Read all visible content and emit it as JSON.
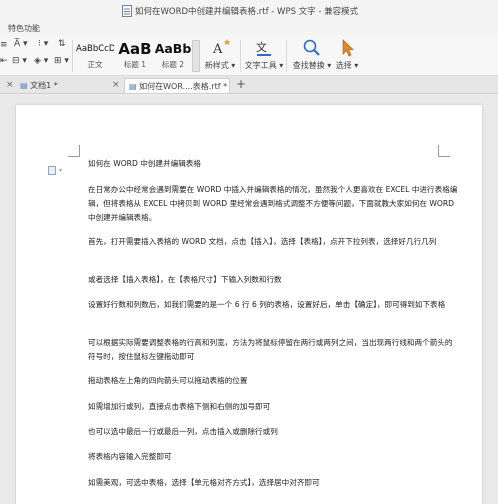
{
  "window": {
    "title": "如何在WORD中创建并编辑表格.rtf - WPS 文字 - 兼容模式"
  },
  "ribbon": {
    "tab_label": "特色功能",
    "styles": [
      {
        "preview": "AaBbCcD",
        "label": "正文"
      },
      {
        "preview": "AaB",
        "label": "标题 1"
      },
      {
        "preview": "AaBb",
        "label": "标题 2"
      }
    ],
    "new_style_label": "新样式",
    "text_tools_label": "文字工具",
    "find_replace_label": "查找替换",
    "select_label": "选择"
  },
  "tabs": [
    {
      "label": "文档1"
    },
    {
      "label": "如何在WOR....表格.rtf"
    }
  ],
  "document": {
    "title": "如何在 WORD 中创建并编辑表格",
    "paragraphs": [
      "在日常办公中经常会遇到需要在 WORD 中插入并编辑表格的情况，虽然我个人更喜欢在 EXCEL 中进行表格编辑，但将表格从 EXCEL 中拷贝到 WORD 里经常会遇到格式调整不方便等问题，下面就教大家如何在 WORD 中创建并编辑表格。",
      "首先，打开需要插入表格的 WORD 文档，点击【插入】，选择【表格】，点开下拉列表，选择好几行几列",
      "或者选择【插入表格】，在【表格尺寸】下输入列数和行数",
      "设置好行数和列数后，如我们需要的是一个 6 行 6 列的表格，设置好后，单击【确定】，即可得到如下表格",
      "可以根据实际需要调整表格的行高和列宽，方法为将鼠标停留在两行或两列之间，当出现两行线和两个箭头的符号时，按住鼠标左键拖动即可",
      "拖动表格左上角的四向箭头可以拖动表格的位置",
      "如需增加行或列，直接点击表格下侧和右侧的加号即可",
      "也可以选中最后一行或最后一列，点击插入或删除行或列",
      "将表格内容输入完整即可",
      "如需美观，可选中表格，选择【单元格对齐方式】，选择居中对齐即可"
    ]
  }
}
